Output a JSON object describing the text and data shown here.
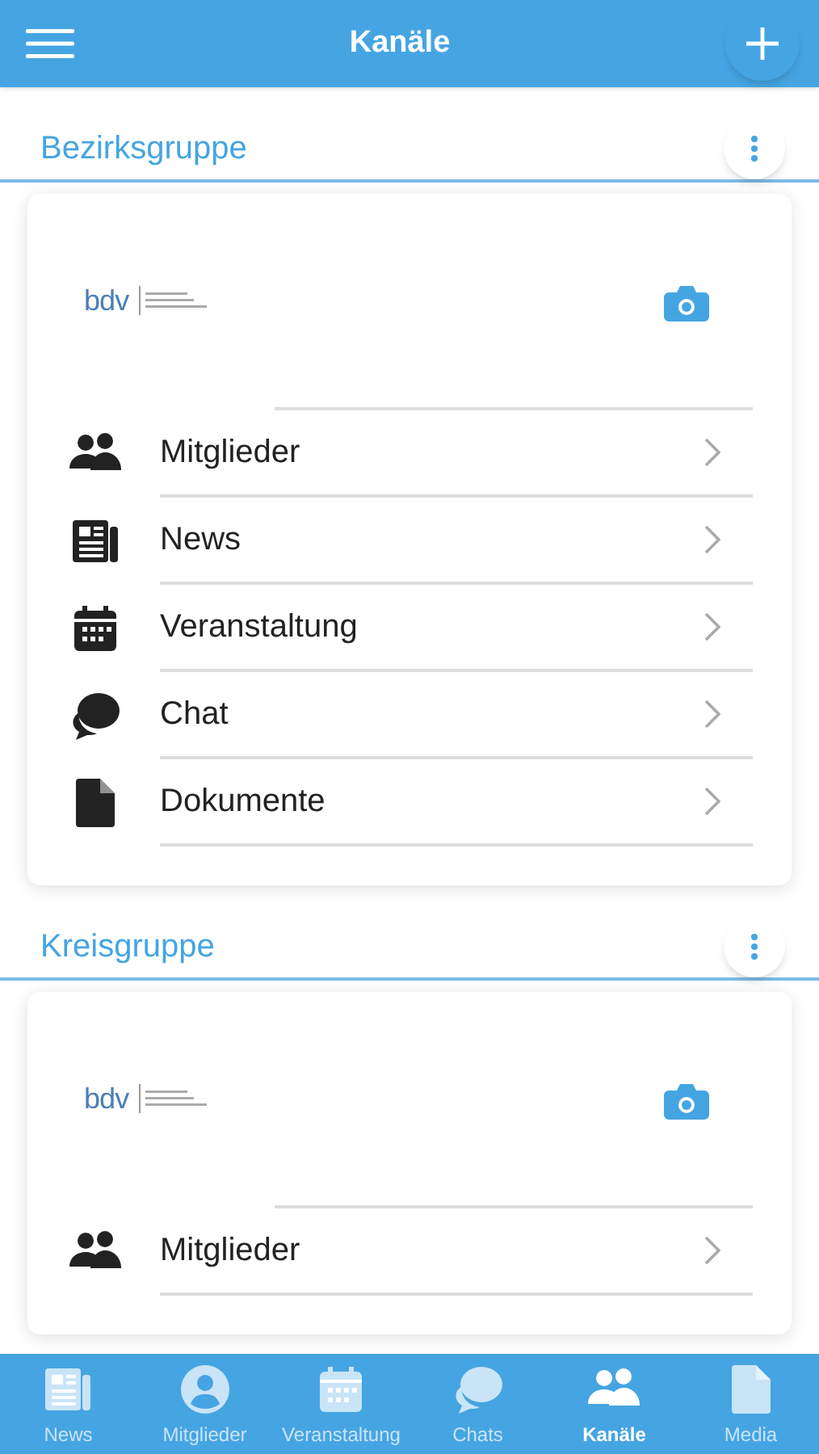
{
  "header": {
    "title": "Kanäle"
  },
  "groups": [
    {
      "title": "Bezirksgruppe",
      "logo": "bdv",
      "items": [
        {
          "kind": "members",
          "label": "Mitglieder"
        },
        {
          "kind": "news",
          "label": "News"
        },
        {
          "kind": "calendar",
          "label": "Veranstaltung"
        },
        {
          "kind": "chat",
          "label": "Chat"
        },
        {
          "kind": "document",
          "label": "Dokumente"
        }
      ]
    },
    {
      "title": "Kreisgruppe",
      "logo": "bdv",
      "items": [
        {
          "kind": "members",
          "label": "Mitglieder"
        }
      ]
    }
  ],
  "bottom_nav": [
    {
      "kind": "news",
      "label": "News",
      "selected": false
    },
    {
      "kind": "profile",
      "label": "Mitglieder",
      "selected": false
    },
    {
      "kind": "calendar",
      "label": "Veranstaltung",
      "selected": false
    },
    {
      "kind": "chat",
      "label": "Chats",
      "selected": false
    },
    {
      "kind": "members",
      "label": "Kanäle",
      "selected": true
    },
    {
      "kind": "document",
      "label": "Media",
      "selected": false
    }
  ]
}
